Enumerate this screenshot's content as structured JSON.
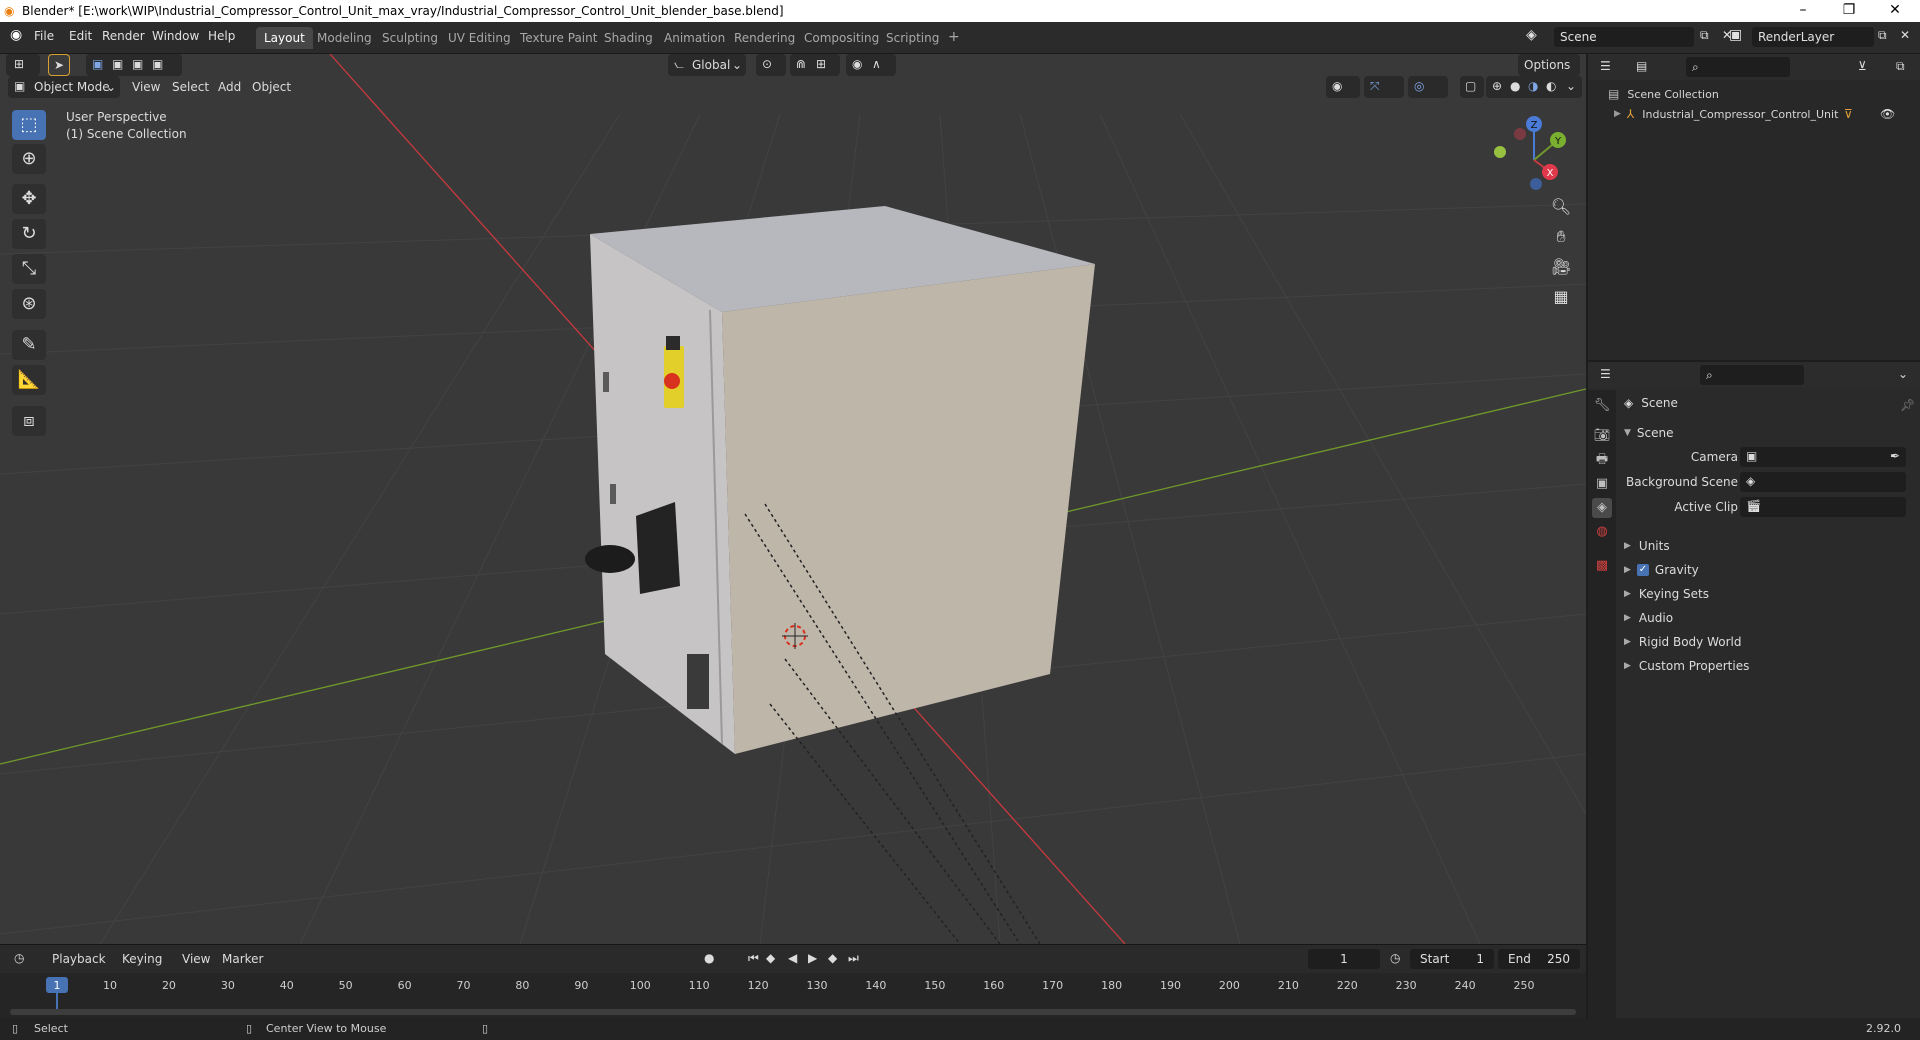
{
  "window": {
    "title": "Blender* [E:\\work\\WIP\\Industrial_Compressor_Control_Unit_max_vray/Industrial_Compressor_Control_Unit_blender_base.blend]",
    "minimize": "–",
    "maximize": "❐",
    "close": "✕"
  },
  "menu": [
    "File",
    "Edit",
    "Render",
    "Window",
    "Help"
  ],
  "workspaces": [
    "Layout",
    "Modeling",
    "Sculpting",
    "UV Editing",
    "Texture Paint",
    "Shading",
    "Animation",
    "Rendering",
    "Compositing",
    "Scripting"
  ],
  "workspace_add": "+",
  "scene_field": "Scene",
  "renderlayer_field": "RenderLayer",
  "viewport": {
    "mode": "Object Mode",
    "menus": [
      "View",
      "Select",
      "Add",
      "Object"
    ],
    "transform_orientation": "Global",
    "options": "Options",
    "overlay_line1": "User Perspective",
    "overlay_line2": "(1) Scene Collection",
    "gizmo_axes": {
      "x": "X",
      "y": "Y",
      "z": "Z"
    }
  },
  "outliner": {
    "root": "Scene Collection",
    "items": [
      {
        "label": "Industrial_Compressor_Control_Unit"
      }
    ]
  },
  "properties": {
    "context": "Scene",
    "panel": "Scene",
    "rows": [
      {
        "label": "Camera"
      },
      {
        "label": "Background Scene"
      },
      {
        "label": "Active Clip"
      }
    ],
    "subpanels": [
      "Units",
      "Gravity",
      "Keying Sets",
      "Audio",
      "Rigid Body World",
      "Custom Properties"
    ],
    "gravity_checked": true
  },
  "timeline": {
    "menus": [
      "Playback",
      "Keying",
      "View",
      "Marker"
    ],
    "current_frame": "1",
    "start_label": "Start",
    "start_value": "1",
    "end_label": "End",
    "end_value": "250",
    "ticks": [
      "1",
      "10",
      "20",
      "30",
      "40",
      "50",
      "60",
      "70",
      "80",
      "90",
      "100",
      "110",
      "120",
      "130",
      "140",
      "150",
      "160",
      "170",
      "180",
      "190",
      "200",
      "210",
      "220",
      "230",
      "240",
      "250"
    ]
  },
  "statusbar": {
    "left_hint": "Select",
    "mid_hint": "Center View to Mouse",
    "version": "2.92.0"
  },
  "colors": {
    "accent": "#4772b3",
    "axis_x": "#c8393f",
    "axis_y": "#6f9a2a",
    "viewport_bg": "#393939"
  }
}
